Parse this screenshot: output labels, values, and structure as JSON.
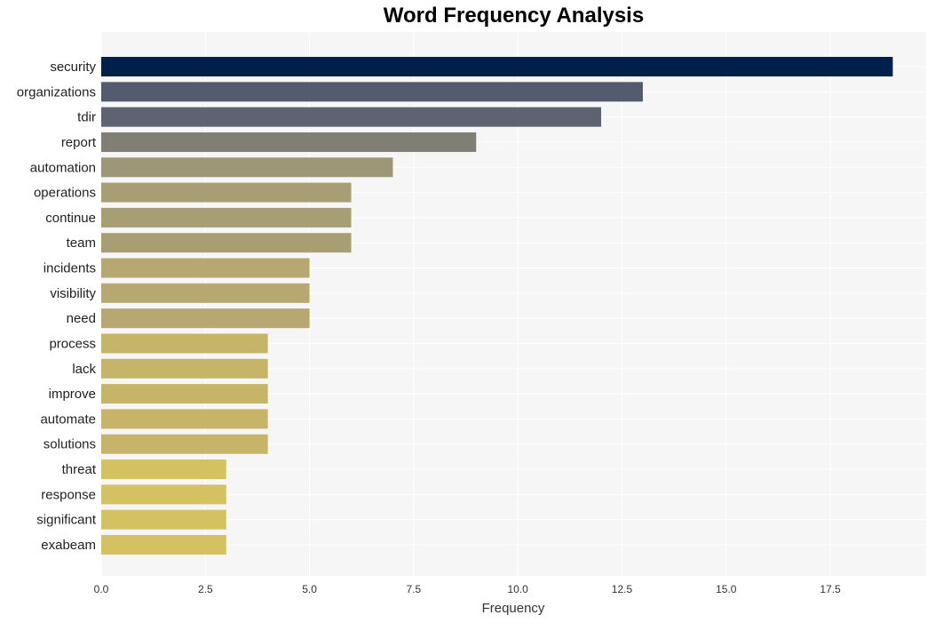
{
  "chart_data": {
    "type": "bar",
    "orientation": "horizontal",
    "title": "Word Frequency Analysis",
    "xlabel": "Frequency",
    "ylabel": "",
    "xlim": [
      0,
      19.8
    ],
    "xticks": [
      0.0,
      2.5,
      5.0,
      7.5,
      10.0,
      12.5,
      15.0,
      17.5
    ],
    "xtick_labels": [
      "0.0",
      "2.5",
      "5.0",
      "7.5",
      "10.0",
      "12.5",
      "15.0",
      "17.5"
    ],
    "grid": true,
    "categories": [
      "security",
      "organizations",
      "tdir",
      "report",
      "automation",
      "operations",
      "continue",
      "team",
      "incidents",
      "visibility",
      "need",
      "process",
      "lack",
      "improve",
      "automate",
      "solutions",
      "threat",
      "response",
      "significant",
      "exabeam"
    ],
    "values": [
      19,
      13,
      12,
      9,
      7,
      6,
      6,
      6,
      5,
      5,
      5,
      4,
      4,
      4,
      4,
      4,
      3,
      3,
      3,
      3
    ],
    "colors": [
      "#00204c",
      "#555b6e",
      "#5f6270",
      "#817e76",
      "#9e9777",
      "#a89e74",
      "#a89e74",
      "#a89e74",
      "#b6a870",
      "#b6a870",
      "#b6a870",
      "#c6b569",
      "#c6b569",
      "#c6b569",
      "#c6b569",
      "#c6b569",
      "#d4c161",
      "#d4c161",
      "#d4c161",
      "#d4c161"
    ]
  },
  "colors": {
    "plot_background": "#f6f6f6",
    "grid": "#ffffff"
  }
}
